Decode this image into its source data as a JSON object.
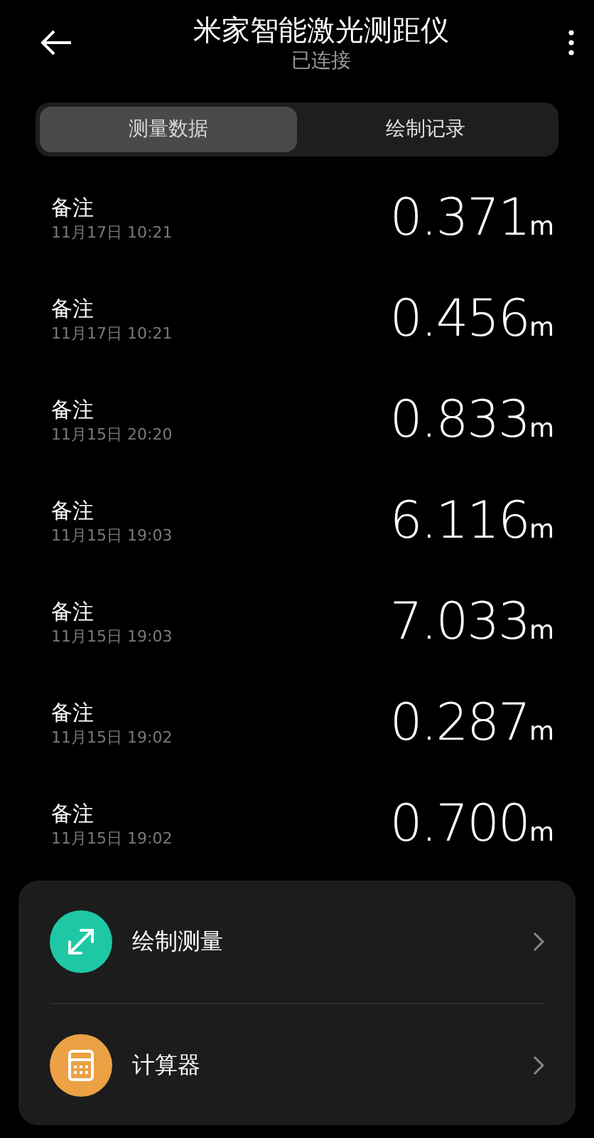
{
  "header": {
    "title": "米家智能激光测距仪",
    "subtitle": "已连接"
  },
  "tabs": [
    {
      "label": "测量数据",
      "selected": true
    },
    {
      "label": "绘制记录",
      "selected": false
    }
  ],
  "records": [
    {
      "note": "备注",
      "time": "11月17日 10:21",
      "value": "0.371",
      "unit": "m"
    },
    {
      "note": "备注",
      "time": "11月17日 10:21",
      "value": "0.456",
      "unit": "m"
    },
    {
      "note": "备注",
      "time": "11月15日 20:20",
      "value": "0.833",
      "unit": "m"
    },
    {
      "note": "备注",
      "time": "11月15日 19:03",
      "value": "6.116",
      "unit": "m"
    },
    {
      "note": "备注",
      "time": "11月15日 19:03",
      "value": "7.033",
      "unit": "m"
    },
    {
      "note": "备注",
      "time": "11月15日 19:02",
      "value": "0.287",
      "unit": "m"
    },
    {
      "note": "备注",
      "time": "11月15日 19:02",
      "value": "0.700",
      "unit": "m"
    }
  ],
  "actions": [
    {
      "kind": "draw",
      "label": "绘制测量",
      "color": "#1ec8a5"
    },
    {
      "kind": "calculator",
      "label": "计算器",
      "color": "#eba144"
    }
  ]
}
